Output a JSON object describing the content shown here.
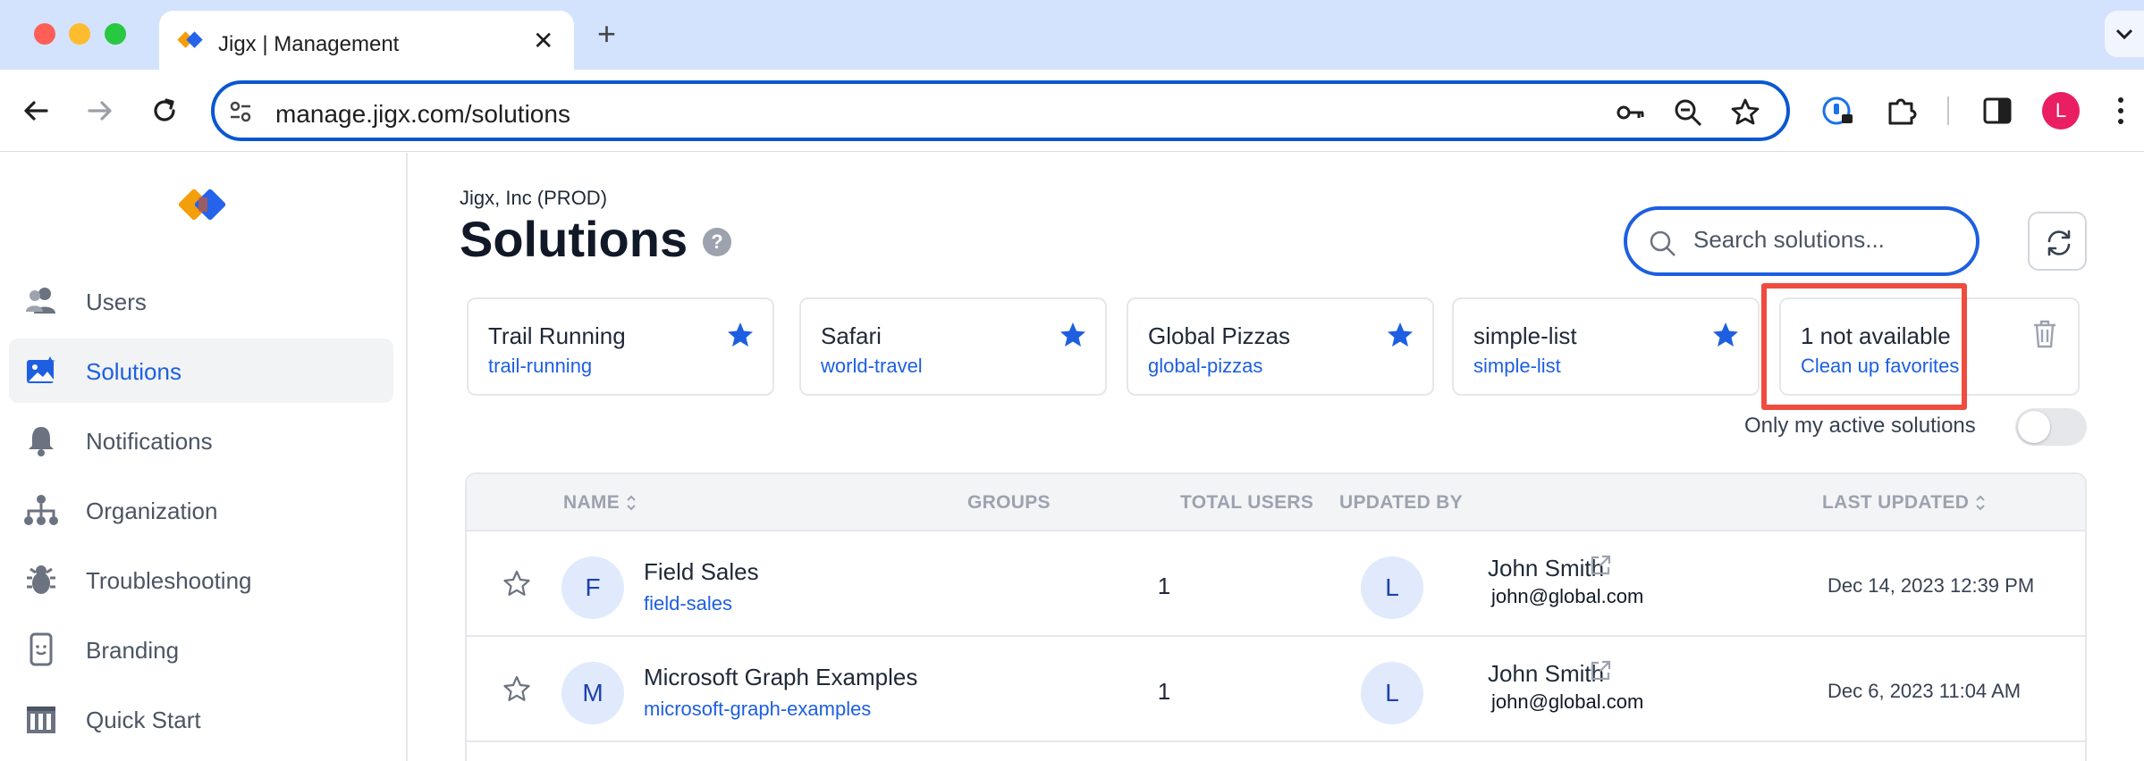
{
  "browser": {
    "tab_title": "Jigx | Management",
    "new_tab_symbol": "+",
    "url": "manage.jigx.com/solutions",
    "profile_initial": "L"
  },
  "sidebar": {
    "items": [
      {
        "label": "Users",
        "icon": "users-icon",
        "active": false
      },
      {
        "label": "Solutions",
        "icon": "solutions-icon",
        "active": true
      },
      {
        "label": "Notifications",
        "icon": "bell-icon",
        "active": false
      },
      {
        "label": "Organization",
        "icon": "org-chart-icon",
        "active": false
      },
      {
        "label": "Troubleshooting",
        "icon": "bug-icon",
        "active": false
      },
      {
        "label": "Branding",
        "icon": "phone-icon",
        "active": false
      },
      {
        "label": "Quick Start",
        "icon": "quick-start-icon",
        "active": false
      }
    ]
  },
  "header": {
    "org_name": "Jigx, Inc (PROD)",
    "title": "Solutions",
    "help": "?",
    "search_placeholder": "Search solutions..."
  },
  "favorites": [
    {
      "name": "Trail Running",
      "slug": "trail-running"
    },
    {
      "name": "Safari",
      "slug": "world-travel"
    },
    {
      "name": "Global Pizzas",
      "slug": "global-pizzas"
    },
    {
      "name": "simple-list",
      "slug": "simple-list"
    }
  ],
  "unavailable": {
    "label": "1 not available",
    "action": "Clean up favorites"
  },
  "filter": {
    "label": "Only my active solutions",
    "enabled": false
  },
  "table": {
    "columns": {
      "name": "NAME",
      "groups": "GROUPS",
      "total_users": "TOTAL USERS",
      "updated_by": "UPDATED BY",
      "last_updated": "LAST UPDATED"
    },
    "rows": [
      {
        "initial": "F",
        "name": "Field Sales",
        "slug": "field-sales",
        "total_users": "1",
        "user_initial": "L",
        "user_name": "John Smith",
        "user_email": "john@global.com",
        "last_updated": "Dec 14, 2023 12:39 PM"
      },
      {
        "initial": "M",
        "name": "Microsoft Graph Examples",
        "slug": "microsoft-graph-examples",
        "total_users": "1",
        "user_initial": "L",
        "user_name": "John Smith",
        "user_email": "john@global.com",
        "last_updated": "Dec 6, 2023 11:04 AM"
      }
    ]
  },
  "colors": {
    "accent": "#1d5fe0",
    "highlight": "#ef4b3f",
    "star": "#1d5fe0"
  }
}
